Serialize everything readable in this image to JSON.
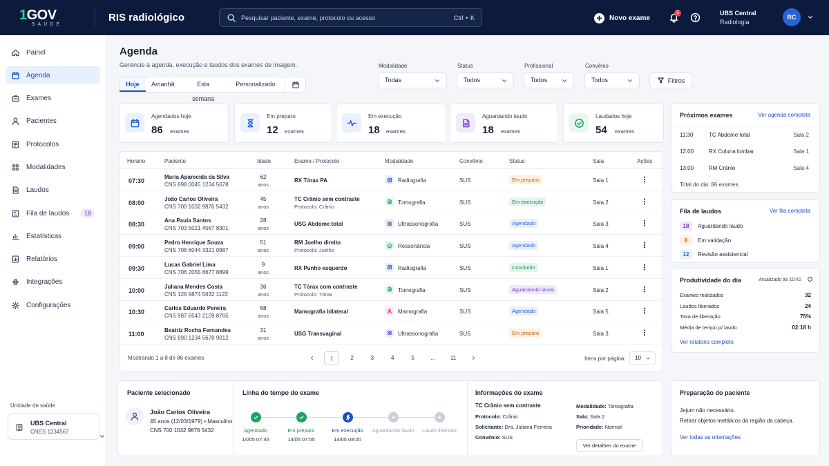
{
  "brand": {
    "logo_main_one": "1",
    "logo_main_rest": "GOV",
    "logo_sub": "SAÚDE",
    "app_title": "RIS radiológico"
  },
  "search": {
    "placeholder": "Pesquisar paciente, exame, protocolo ou acesso",
    "shortcut": "Ctrl + K"
  },
  "topbar": {
    "new_exam": "Novo exame",
    "notif_count": "5",
    "unit_name": "UBS Central",
    "unit_dept": "Radiologia",
    "avatar_initials": "RC"
  },
  "sidebar": {
    "items": [
      {
        "label": "Painel",
        "icon": "home-icon"
      },
      {
        "label": "Agenda",
        "icon": "calendar-icon",
        "active": true
      },
      {
        "label": "Exames",
        "icon": "exams-icon"
      },
      {
        "label": "Pacientes",
        "icon": "user-icon"
      },
      {
        "label": "Protocolos",
        "icon": "protocols-icon"
      },
      {
        "label": "Modalidades",
        "icon": "modalities-icon"
      },
      {
        "label": "Laudos",
        "icon": "report-icon"
      },
      {
        "label": "Fila de laudos",
        "icon": "queue-icon",
        "badge": "18"
      },
      {
        "label": "Estatísticas",
        "icon": "chart-icon"
      },
      {
        "label": "Relatórios",
        "icon": "reports-icon"
      },
      {
        "label": "Integrações",
        "icon": "integration-icon"
      },
      {
        "label": "Configurações",
        "icon": "gear-icon"
      }
    ],
    "unit_label": "Unidade de saúde",
    "unit_name": "UBS Central",
    "unit_cnes": "CNES 1234567"
  },
  "header": {
    "title": "Agenda",
    "subtitle": "Gerencie a agenda, execução e laudos dos exames de imagem."
  },
  "tabs": [
    "Hoje",
    "Amanhã",
    "Esta semana",
    "Personalizado"
  ],
  "filters": {
    "modalidade": {
      "label": "Modalidade",
      "value": "Todas"
    },
    "status": {
      "label": "Status",
      "value": "Todos"
    },
    "profissional": {
      "label": "Profissional",
      "value": "Todos"
    },
    "convenio": {
      "label": "Convênio",
      "value": "Todos"
    },
    "button": "Filtros"
  },
  "stats": [
    {
      "label": "Agendados hoje",
      "value": "86",
      "unit": "exames",
      "icon": "calendar-icon",
      "color": "#2a63d4",
      "bg": "#eaf1fe"
    },
    {
      "label": "Em preparo",
      "value": "12",
      "unit": "exames",
      "icon": "hourglass-icon",
      "color": "#2a63d4",
      "bg": "#eaf1fe"
    },
    {
      "label": "Em execução",
      "value": "18",
      "unit": "exames",
      "icon": "pulse-icon",
      "color": "#2a63d4",
      "bg": "#eaf1fe"
    },
    {
      "label": "Aguardando laudo",
      "value": "18",
      "unit": "exames",
      "icon": "document-icon",
      "color": "#7b4bd1",
      "bg": "#f1eafc"
    },
    {
      "label": "Laudados hoje",
      "value": "54",
      "unit": "exames",
      "icon": "check-icon",
      "color": "#1f9d66",
      "bg": "#e7f6ee"
    }
  ],
  "table": {
    "headers": [
      "Horário",
      "Paciente",
      "Idade",
      "Exame / Protocolo",
      "Modalidade",
      "Convênio",
      "Status",
      "Sala",
      "Ações"
    ],
    "age_unit": "anos",
    "rows": [
      {
        "time": "07:30",
        "name": "Maria Aparecida da Silva",
        "cns": "CNS 898 0045 1234 5678",
        "age": "62",
        "exam": "RX Tórax PA",
        "protocol": "",
        "modality": "Radiografia",
        "mod_color": "#2a63d4",
        "mod_bg": "#eaf1fe",
        "conv": "SUS",
        "status": "Em preparo",
        "st_color": "#c2620a",
        "st_bg": "#fdf0e1",
        "room": "Sala 1"
      },
      {
        "time": "08:00",
        "name": "João Carlos Oliveira",
        "cns": "CNS 700 1032 9876 5432",
        "age": "45",
        "exam": "TC Crânio sem contraste",
        "protocol": "Protocolo: Crânio",
        "modality": "Tomografia",
        "mod_color": "#1f9d66",
        "mod_bg": "#e7f6ee",
        "conv": "SUS",
        "status": "Em execução",
        "st_color": "#1f8a57",
        "st_bg": "#e4f5ec",
        "room": "Sala 2"
      },
      {
        "time": "08:30",
        "name": "Ana Paula Santos",
        "cns": "CNS 703 5021 4567 8901",
        "age": "28",
        "exam": "USG Abdome total",
        "protocol": "",
        "modality": "Ultrassonografia",
        "mod_color": "#7b4bd1",
        "mod_bg": "#f1eafc",
        "conv": "SUS",
        "status": "Agendado",
        "st_color": "#2a63d4",
        "st_bg": "#e8f0fd",
        "room": "Sala 3"
      },
      {
        "time": "09:00",
        "name": "Pedro Henrique Souza",
        "cns": "CNS 708 6044 3321 0987",
        "age": "51",
        "exam": "RM Joelho direito",
        "protocol": "Protocolo: Joelho",
        "modality": "Ressonância",
        "mod_color": "#1b9a8a",
        "mod_bg": "#e4f5f2",
        "conv": "SUS",
        "status": "Agendado",
        "st_color": "#2a63d4",
        "st_bg": "#e8f0fd",
        "room": "Sala 4"
      },
      {
        "time": "09:30",
        "name": "Lucas Gabriel Lima",
        "cns": "CNS 706 2055 6677 8899",
        "age": "9",
        "exam": "RX Punho esquerdo",
        "protocol": "",
        "modality": "Radiografia",
        "mod_color": "#2a63d4",
        "mod_bg": "#eaf1fe",
        "conv": "SUS",
        "status": "Concluído",
        "st_color": "#1f8a57",
        "st_bg": "#e4f5ec",
        "room": "Sala 1"
      },
      {
        "time": "10:00",
        "name": "Juliana Mendes Costa",
        "cns": "CNS 126 9874 5632 1122",
        "age": "36",
        "exam": "TC Tórax com contraste",
        "protocol": "Protocolo: Tórax",
        "modality": "Tomografia",
        "mod_color": "#1f9d66",
        "mod_bg": "#e7f6ee",
        "conv": "SUS",
        "status": "Aguardando laudo",
        "st_color": "#6b3fc8",
        "st_bg": "#f0e8fc",
        "room": "Sala 2"
      },
      {
        "time": "10:30",
        "name": "Carlos Eduardo Pereira",
        "cns": "CNS 987 6543 2109 8765",
        "age": "68",
        "exam": "Mamografia bilateral",
        "protocol": "",
        "modality": "Mamografia",
        "mod_color": "#d23d7a",
        "mod_bg": "#fce8f0",
        "conv": "SUS",
        "status": "Agendado",
        "st_color": "#2a63d4",
        "st_bg": "#e8f0fd",
        "room": "Sala 5"
      },
      {
        "time": "11:00",
        "name": "Beatriz Rocha Fernandes",
        "cns": "CNS 890 1234 5678 9012",
        "age": "31",
        "exam": "USG Transvaginal",
        "protocol": "",
        "modality": "Ultrassonografia",
        "mod_color": "#7b4bd1",
        "mod_bg": "#f1eafc",
        "conv": "SUS",
        "status": "Em preparo",
        "st_color": "#c2620a",
        "st_bg": "#fdf0e1",
        "room": "Sala 3"
      }
    ],
    "footer": "Mostrando 1 a 8 de 86 exames",
    "pages": [
      "1",
      "2",
      "3",
      "4",
      "5",
      "...",
      "11"
    ],
    "per_page_label": "Itens por página:",
    "per_page": "10"
  },
  "next_exams": {
    "title": "Próximos exames",
    "link": "Ver agenda completa",
    "items": [
      {
        "time": "11:30",
        "exam": "TC Abdome total",
        "room": "Sala 2"
      },
      {
        "time": "12:00",
        "exam": "RX Coluna lombar",
        "room": "Sala 1"
      },
      {
        "time": "13:00",
        "exam": "RM Crânio",
        "room": "Sala 4"
      }
    ],
    "total": "Total do dia: 86 exames"
  },
  "report_queue": {
    "title": "Fila de laudos",
    "link": "Ver fila completa",
    "items": [
      {
        "count": "18",
        "label": "Aguardando laudo",
        "color": "#6b3fc8",
        "bg": "#f0e8fc"
      },
      {
        "count": "6",
        "label": "Em validação",
        "color": "#c2620a",
        "bg": "#fdf0e1"
      },
      {
        "count": "12",
        "label": "Revisão assistencial",
        "color": "#2a63d4",
        "bg": "#e8f0fd"
      }
    ]
  },
  "productivity": {
    "title": "Produtividade do dia",
    "updated": "Atualizado às 10:42",
    "items": [
      {
        "label": "Exames realizados",
        "value": "32"
      },
      {
        "label": "Laudos liberados",
        "value": "24"
      },
      {
        "label": "Taxa de liberação",
        "value": "75%"
      },
      {
        "label": "Média de tempo p/ laudo",
        "value": "02:18 h"
      }
    ],
    "link": "Ver relatório completo"
  },
  "selected_patient": {
    "title": "Paciente selecionado",
    "name": "João Carlos Oliveira",
    "info": "45 anos (12/03/1979) • Masculino",
    "cns": "CNS 700 1032 9876 5432"
  },
  "timeline": {
    "title": "Linha do tempo do exame",
    "steps": [
      {
        "label": "Agendado",
        "time": "14/05 07:45",
        "state": "done"
      },
      {
        "label": "Em preparo",
        "time": "14/05 07:55",
        "state": "done"
      },
      {
        "label": "Em execução",
        "time": "14/05 08:00",
        "state": "current"
      },
      {
        "label": "Aguardando laudo",
        "time": "",
        "state": "pending"
      },
      {
        "label": "Laudo liberado",
        "time": "",
        "state": "pending"
      }
    ]
  },
  "exam_info": {
    "title": "Informações do exame",
    "exam": "TC Crânio sem contraste",
    "protocol_label": "Protocolo:",
    "protocol": "Crânio",
    "requester_label": "Solicitante:",
    "requester": "Dra. Juliana Ferreira",
    "convenio_label": "Convênio:",
    "convenio": "SUS",
    "modality_label": "Modalidade:",
    "modality": "Tomografia",
    "room_label": "Sala:",
    "room": "Sala 2",
    "priority_label": "Prioridade:",
    "priority": "Normal",
    "button": "Ver detalhes do exame"
  },
  "prep": {
    "title": "Preparação do paciente",
    "lines": [
      "Jejum não necessário.",
      "Retirar objetos metálicos da região da cabeça."
    ],
    "link": "Ver todas as orientações"
  }
}
